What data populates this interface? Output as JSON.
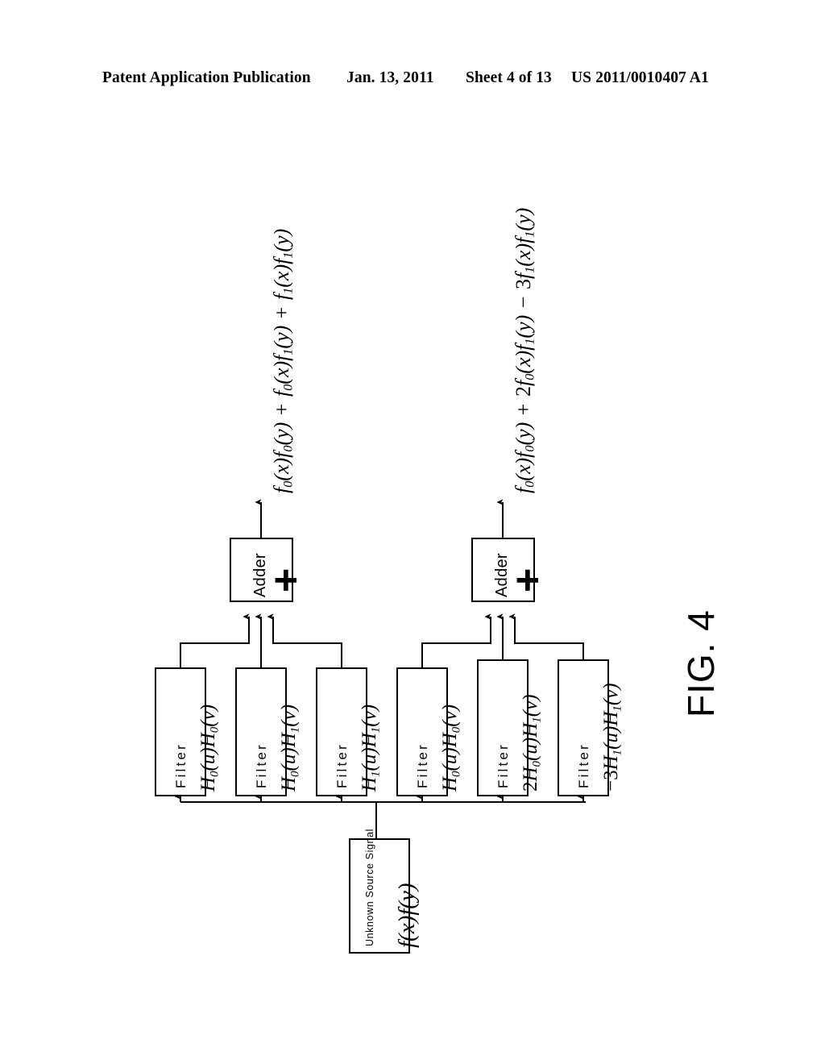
{
  "header": {
    "publication": "Patent Application Publication",
    "date": "Jan. 13, 2011",
    "sheet": "Sheet 4 of 13",
    "number": "US 2011/0010407 A1"
  },
  "figure": {
    "label": "FIG. 4",
    "source": {
      "title": "Unknown Source Signal",
      "equation": "f(x)f(y)"
    },
    "adders": [
      {
        "label": "Adder",
        "symbol": "+"
      },
      {
        "label": "Adder",
        "symbol": "+"
      }
    ],
    "filters": [
      {
        "label": "Filter",
        "equation_html": "H<sub>0</sub>(u)H<sub>0</sub>(v)",
        "equation": "H0(u)H0(v)"
      },
      {
        "label": "Filter",
        "equation_html": "H<sub>0</sub>(u)H<sub>1</sub>(v)",
        "equation": "H0(u)H1(v)"
      },
      {
        "label": "Filter",
        "equation_html": "H<sub>1</sub>(u)H<sub>1</sub>(v)",
        "equation": "H1(u)H1(v)"
      },
      {
        "label": "Filter",
        "equation_html": "H<sub>0</sub>(u)H<sub>0</sub>(v)",
        "equation": "H0(u)H0(v)"
      },
      {
        "label": "Filter",
        "equation_html": "<span class=\"num\">2</span>H<sub>0</sub>(u)H<sub>1</sub>(v)",
        "equation": "2H0(u)H1(v)"
      },
      {
        "label": "Filter",
        "equation_html": "<span class=\"num\">−3</span>H<sub>1</sub>(u)H<sub>1</sub>(v)",
        "equation": "-3H1(u)H1(v)"
      }
    ],
    "outputs": [
      {
        "equation_html": "f<sub>0</sub>(x)f<sub>0</sub>(y) <span class=\"op\">+</span> f<sub>0</sub>(x)f<sub>1</sub>(y) <span class=\"op\">+</span> f<sub>1</sub>(x)f<sub>1</sub>(y)",
        "equation": "f0(x)f0(y) + f0(x)f1(y) + f1(x)f1(y)"
      },
      {
        "equation_html": "f<sub>0</sub>(x)f<sub>0</sub>(y) <span class=\"op\">+</span> <span class=\"num\">2</span>f<sub>0</sub>(x)f<sub>1</sub>(y) <span class=\"op\">−</span> <span class=\"num\">3</span>f<sub>1</sub>(x)f<sub>1</sub>(y)",
        "equation": "f0(x)f0(y) + 2f0(x)f1(y) - 3f1(x)f1(y)"
      }
    ]
  },
  "colors": {
    "ink": "#000000",
    "paper": "#ffffff"
  }
}
